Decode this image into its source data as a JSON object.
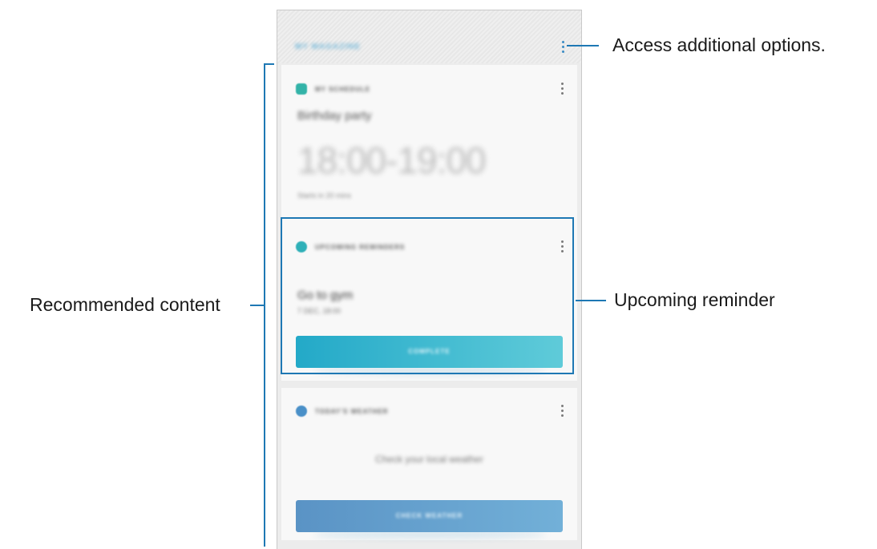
{
  "topbar": {
    "title": "MY MAGAZINE"
  },
  "cards": {
    "schedule": {
      "label": "MY SCHEDULE",
      "event_title": "Birthday party",
      "event_time": "18:00-19:00",
      "event_sub": "Starts in 20 mins"
    },
    "reminder": {
      "label": "UPCOMING REMINDERS",
      "title": "Go to gym",
      "subtitle": "7 DEC, 18:00",
      "button": "COMPLETE"
    },
    "weather": {
      "label": "TODAY'S WEATHER",
      "text": "Check your local weather",
      "button": "CHECK WEATHER"
    }
  },
  "callouts": {
    "options": "Access additional options.",
    "reminder": "Upcoming reminder",
    "recommended": "Recommended content"
  },
  "colors": {
    "accent": "#1e78b4",
    "complete_button": "#23a9c8",
    "weather_button": "#5a93c5"
  }
}
